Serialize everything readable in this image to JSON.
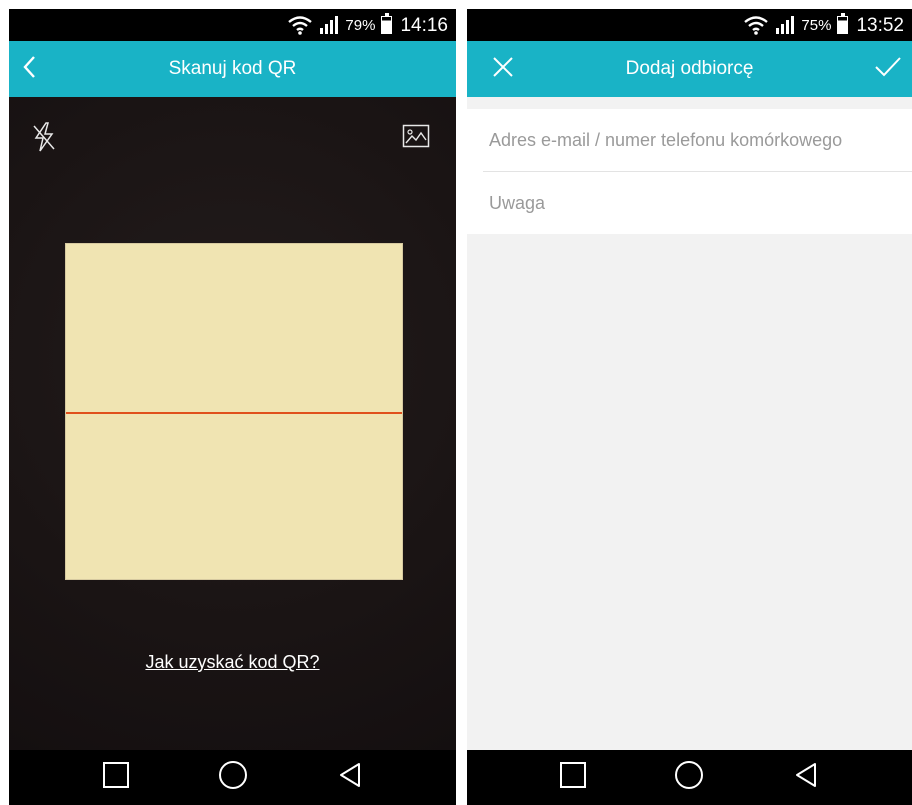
{
  "left_screen": {
    "statusbar": {
      "battery_percent": "79%",
      "time": "14:16"
    },
    "appbar": {
      "title": "Skanuj kod QR",
      "back_icon": "chevron-left-icon"
    },
    "scanner": {
      "flash_icon": "flash-off-icon",
      "gallery_icon": "image-gallery-icon",
      "help_link": "Jak uzyskać kod QR?"
    }
  },
  "right_screen": {
    "statusbar": {
      "battery_percent": "75%",
      "time": "13:52"
    },
    "appbar": {
      "title": "Dodaj odbiorcę",
      "close_icon": "close-icon",
      "confirm_icon": "checkmark-icon"
    },
    "form": {
      "recipient_placeholder": "Adres e-mail / numer telefonu komórkowego",
      "recipient_value": "",
      "note_placeholder": "Uwaga",
      "note_value": ""
    }
  },
  "navbar": {
    "icons": [
      "recent-apps-icon",
      "home-icon",
      "back-icon"
    ]
  },
  "colors": {
    "appbar": "#19b3c6",
    "scan_frame": "#f0e4b2",
    "scan_line": "#e0501c",
    "scanner_bg": "#1a1414"
  }
}
